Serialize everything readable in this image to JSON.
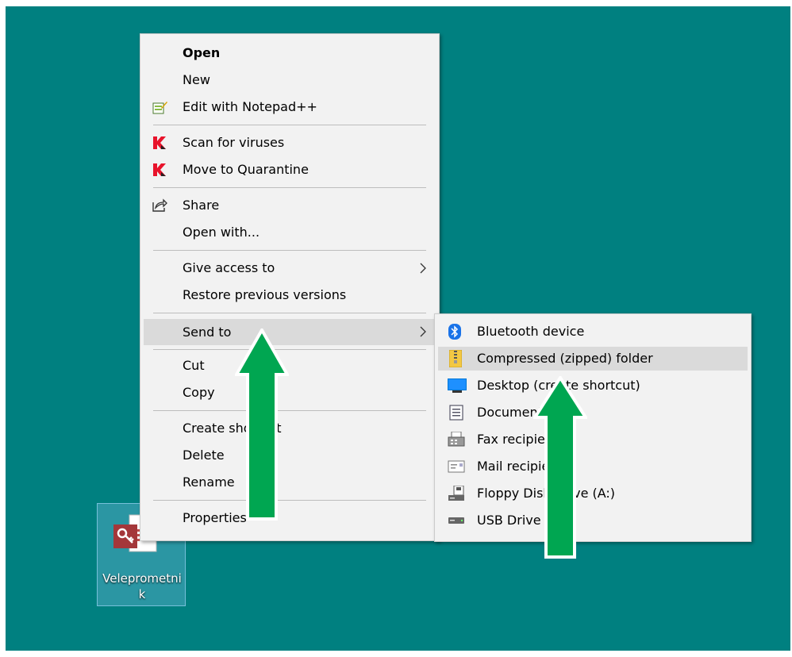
{
  "desktop": {
    "icon_label": "Veleprometnik"
  },
  "context_menu": {
    "items": [
      {
        "label": "Open"
      },
      {
        "label": "New"
      },
      {
        "label": "Edit with Notepad++"
      },
      {
        "label": "Scan for viruses"
      },
      {
        "label": "Move to Quarantine"
      },
      {
        "label": "Share"
      },
      {
        "label": "Open with..."
      },
      {
        "label": "Give access to"
      },
      {
        "label": "Restore previous versions"
      },
      {
        "label": "Send to"
      },
      {
        "label": "Cut"
      },
      {
        "label": "Copy"
      },
      {
        "label": "Create shortcut"
      },
      {
        "label": "Delete"
      },
      {
        "label": "Rename"
      },
      {
        "label": "Properties"
      }
    ]
  },
  "send_to_menu": {
    "items": [
      {
        "label": "Bluetooth device"
      },
      {
        "label": "Compressed (zipped) folder"
      },
      {
        "label": "Desktop (create shortcut)"
      },
      {
        "label": "Documents"
      },
      {
        "label": "Fax recipient"
      },
      {
        "label": "Mail recipient"
      },
      {
        "label": "Floppy Disk Drive (A:)"
      },
      {
        "label": "USB Drive"
      }
    ]
  },
  "colors": {
    "desktop": "#008080",
    "menu_bg": "#f2f2f2",
    "highlight": "#dadada",
    "annotation_arrow": "#00a651"
  }
}
